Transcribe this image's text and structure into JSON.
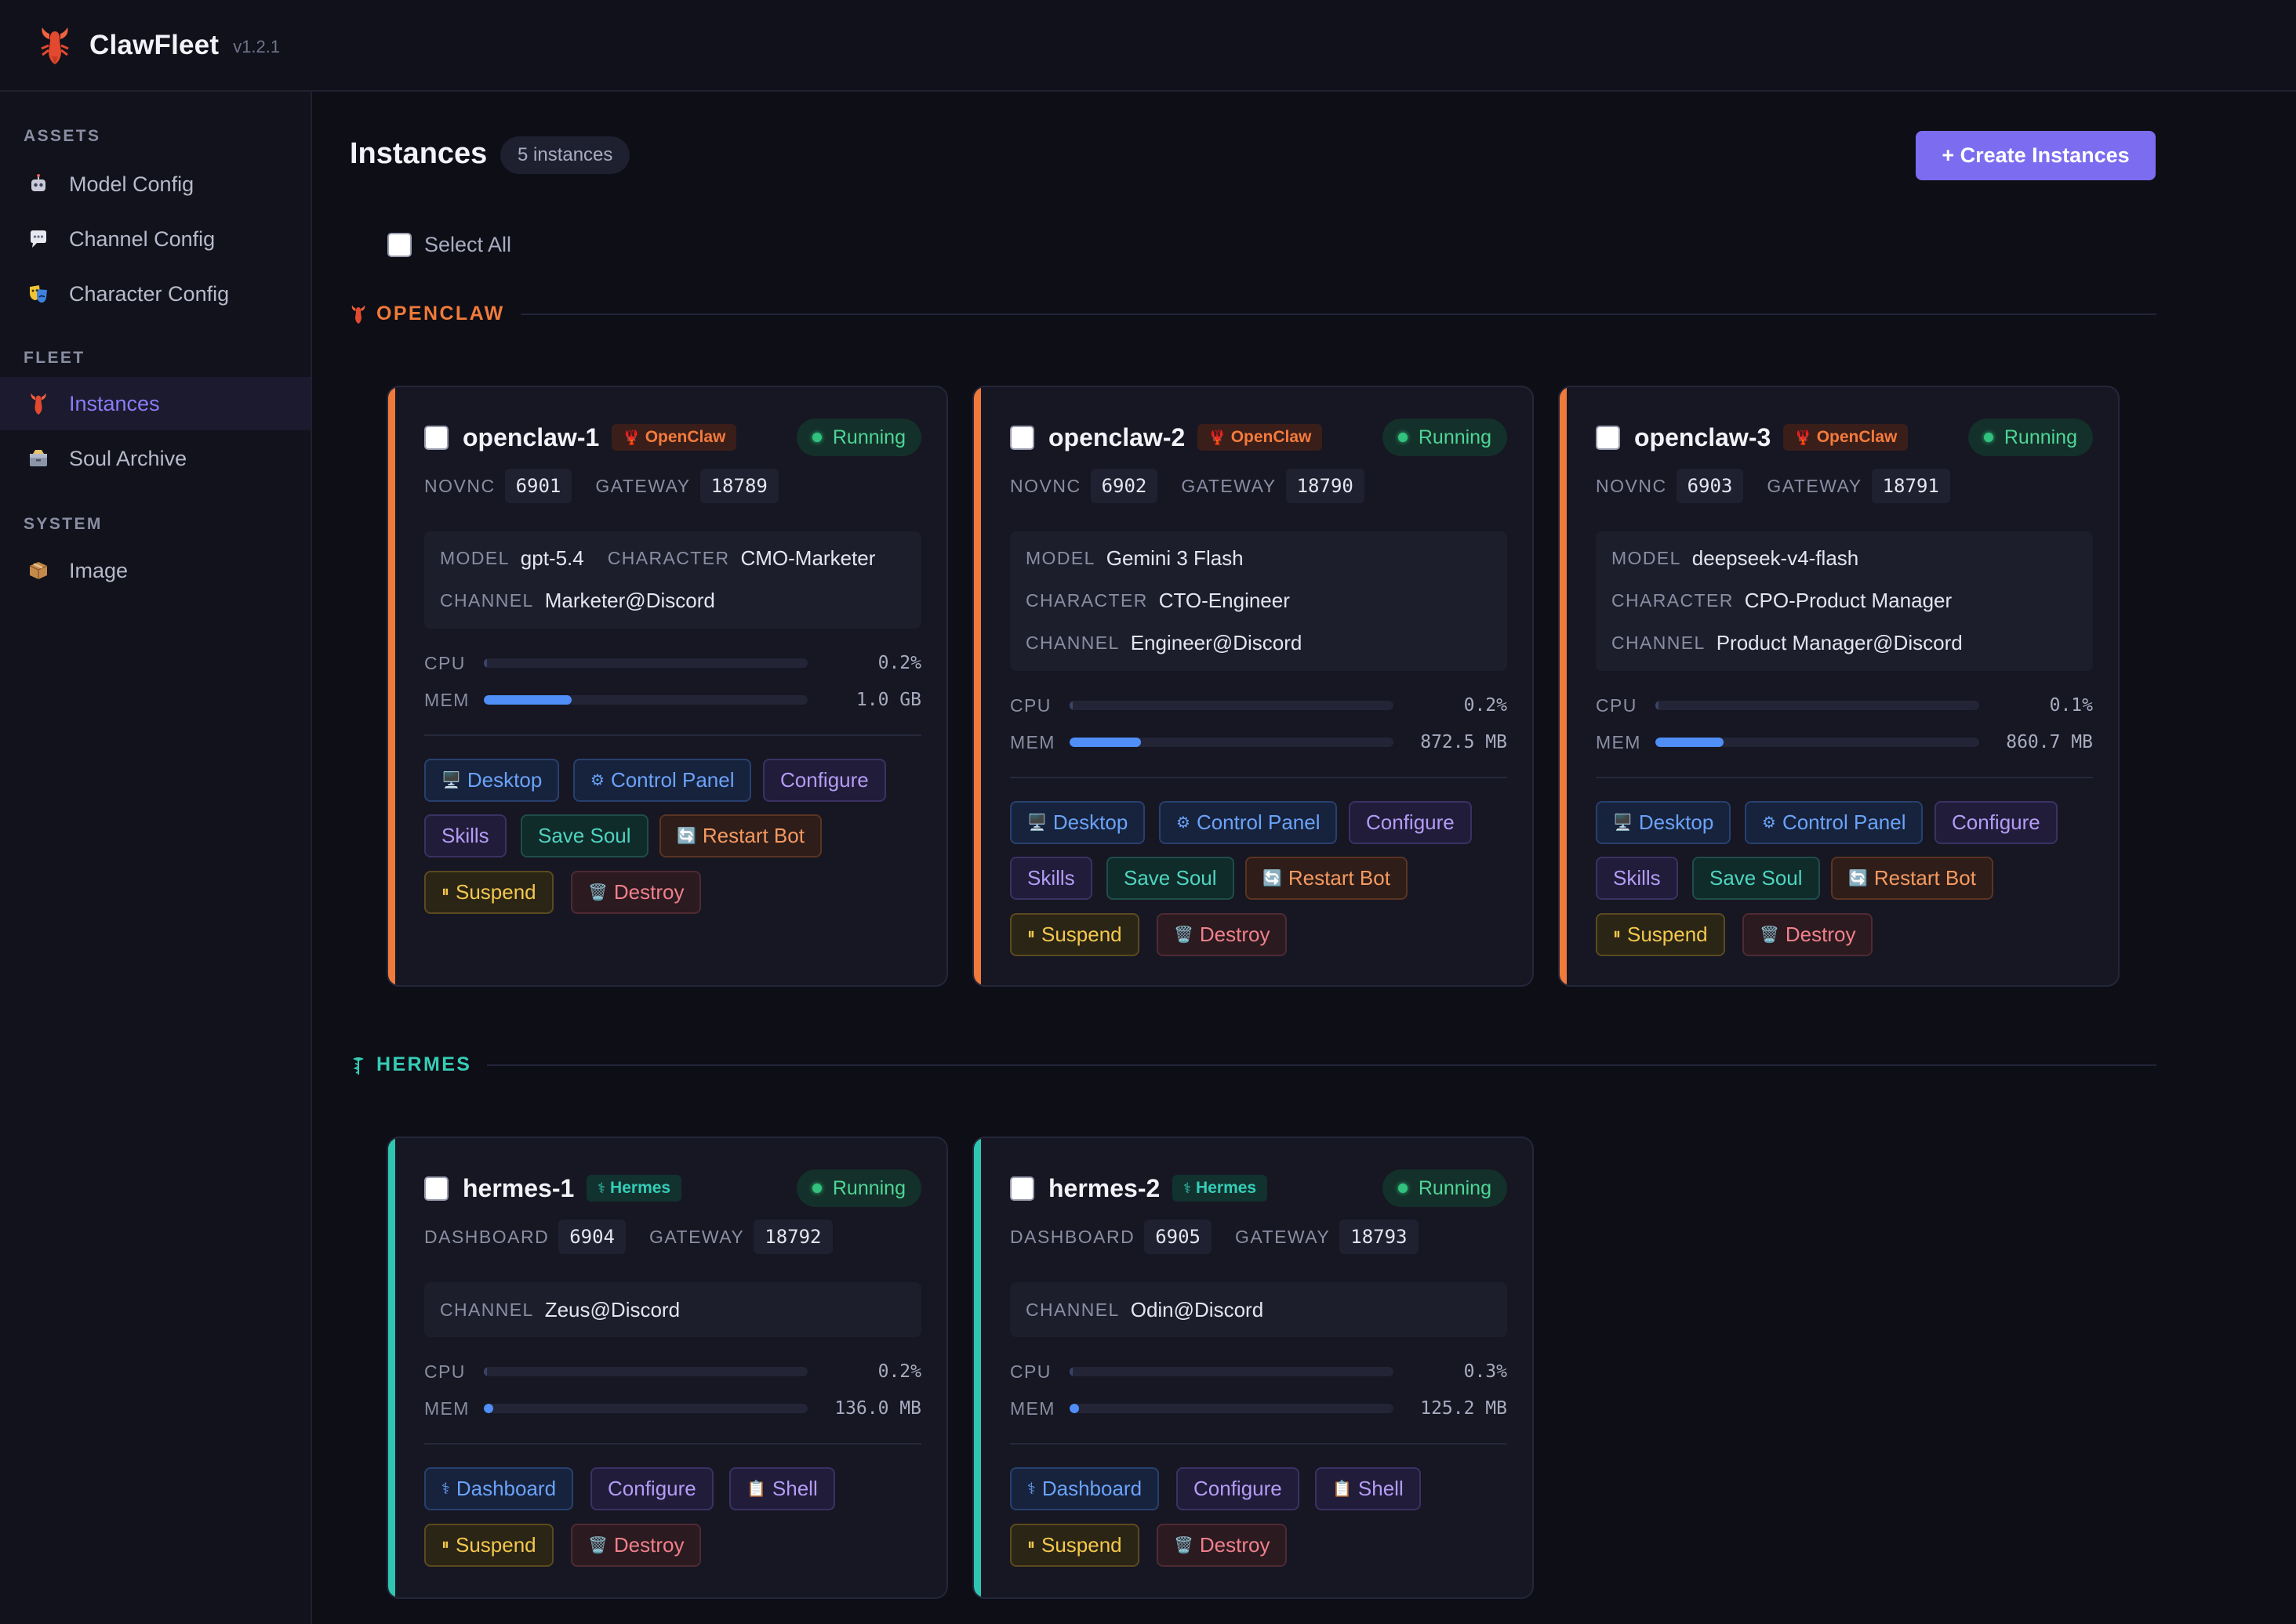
{
  "app": {
    "name": "ClawFleet",
    "version": "v1.2.1"
  },
  "sidebar": {
    "sections": [
      {
        "title": "ASSETS",
        "items": [
          {
            "label": "Model Config",
            "icon": "robot-icon"
          },
          {
            "label": "Channel Config",
            "icon": "speech-bubble-icon"
          },
          {
            "label": "Character Config",
            "icon": "theater-masks-icon"
          }
        ]
      },
      {
        "title": "FLEET",
        "items": [
          {
            "label": "Instances",
            "icon": "lobster-icon",
            "active": true
          },
          {
            "label": "Soul Archive",
            "icon": "archive-box-icon"
          }
        ]
      },
      {
        "title": "SYSTEM",
        "items": [
          {
            "label": "Image",
            "icon": "package-icon"
          }
        ]
      }
    ]
  },
  "main": {
    "title": "Instances",
    "count_label": "5 instances",
    "create_label": "+ Create Instances",
    "select_all_label": "Select All"
  },
  "groups": [
    {
      "title": "OPENCLAW",
      "color": "#f07a3a",
      "icon": "lobster-icon"
    },
    {
      "title": "HERMES",
      "color": "#35cdb6",
      "icon": "caduceus-icon"
    }
  ],
  "status_label": "Running",
  "instances": [
    {
      "name": "openclaw-1",
      "type": "OpenClaw",
      "ports": [
        {
          "label": "NOVNC",
          "value": "6901"
        },
        {
          "label": "GATEWAY",
          "value": "18789"
        }
      ],
      "info": {
        "model": "gpt-5.4",
        "character": "CMO-Marketer",
        "channel": "Marketer@Discord"
      },
      "cpu": {
        "percent": 0.2,
        "label": "0.2%"
      },
      "mem": {
        "fraction": 0.27,
        "label": "1.0 GB"
      },
      "buttons": [
        "Desktop",
        "Control Panel",
        "Configure",
        "Skills",
        "Save Soul",
        "Restart Bot",
        "Suspend",
        "Destroy"
      ]
    },
    {
      "name": "openclaw-2",
      "type": "OpenClaw",
      "ports": [
        {
          "label": "NOVNC",
          "value": "6902"
        },
        {
          "label": "GATEWAY",
          "value": "18790"
        }
      ],
      "info": {
        "model": "Gemini 3 Flash",
        "character": "CTO-Engineer",
        "channel": "Engineer@Discord"
      },
      "cpu": {
        "percent": 0.2,
        "label": "0.2%"
      },
      "mem": {
        "fraction": 0.22,
        "label": "872.5 MB"
      },
      "buttons": [
        "Desktop",
        "Control Panel",
        "Configure",
        "Skills",
        "Save Soul",
        "Restart Bot",
        "Suspend",
        "Destroy"
      ]
    },
    {
      "name": "openclaw-3",
      "type": "OpenClaw",
      "ports": [
        {
          "label": "NOVNC",
          "value": "6903"
        },
        {
          "label": "GATEWAY",
          "value": "18791"
        }
      ],
      "info": {
        "model": "deepseek-v4-flash",
        "character": "CPO-Product Manager",
        "channel": "Product Manager@Discord"
      },
      "cpu": {
        "percent": 0.1,
        "label": "0.1%"
      },
      "mem": {
        "fraction": 0.21,
        "label": "860.7 MB"
      },
      "buttons": [
        "Desktop",
        "Control Panel",
        "Configure",
        "Skills",
        "Save Soul",
        "Restart Bot",
        "Suspend",
        "Destroy"
      ]
    },
    {
      "name": "hermes-1",
      "type": "Hermes",
      "ports": [
        {
          "label": "DASHBOARD",
          "value": "6904"
        },
        {
          "label": "GATEWAY",
          "value": "18792"
        }
      ],
      "info": {
        "channel": "Zeus@Discord"
      },
      "cpu": {
        "percent": 0.2,
        "label": "0.2%"
      },
      "mem": {
        "fraction": 0.03,
        "label": "136.0 MB"
      },
      "buttons": [
        "Dashboard",
        "Configure",
        "Shell",
        "Suspend",
        "Destroy"
      ]
    },
    {
      "name": "hermes-2",
      "type": "Hermes",
      "ports": [
        {
          "label": "DASHBOARD",
          "value": "6905"
        },
        {
          "label": "GATEWAY",
          "value": "18793"
        }
      ],
      "info": {
        "channel": "Odin@Discord"
      },
      "cpu": {
        "percent": 0.3,
        "label": "0.3%"
      },
      "mem": {
        "fraction": 0.03,
        "label": "125.2 MB"
      },
      "buttons": [
        "Dashboard",
        "Configure",
        "Shell",
        "Suspend",
        "Destroy"
      ]
    }
  ],
  "labels": {
    "model": "MODEL",
    "character": "CHARACTER",
    "channel": "CHANNEL",
    "cpu": "CPU",
    "mem": "MEM"
  },
  "colors": {
    "accent": "#7b6cf0",
    "openclaw": "#f07a3a",
    "hermes": "#2fc6b1",
    "running": "#31c37e",
    "mem_bar": "#4f8ff7"
  }
}
